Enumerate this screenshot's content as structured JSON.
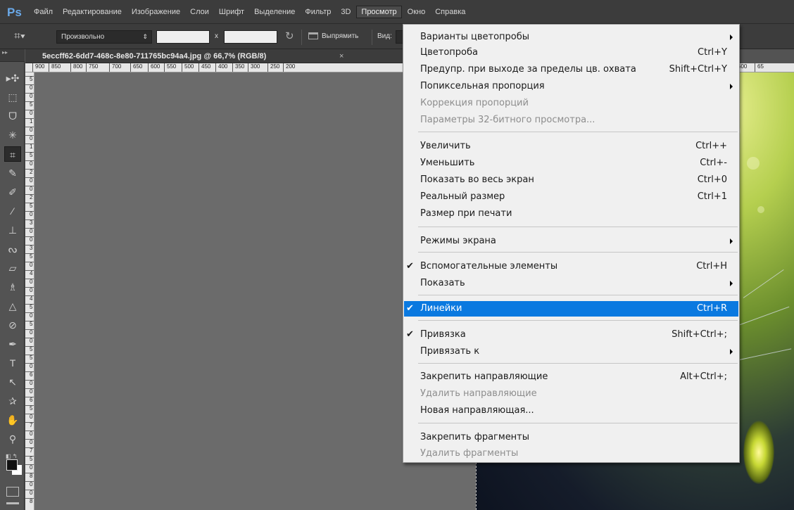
{
  "app": {
    "logo": "Ps"
  },
  "menubar": {
    "items": [
      "Файл",
      "Редактирование",
      "Изображение",
      "Слои",
      "Шрифт",
      "Выделение",
      "Фильтр",
      "3D",
      "Просмотр",
      "Окно",
      "Справка"
    ],
    "active": "Просмотр"
  },
  "options": {
    "preset": "Произвольно",
    "width_value": "",
    "x_label": "x",
    "height_value": "",
    "straighten_label": "Выпрямить",
    "view_label": "Вид:"
  },
  "document": {
    "title": "5eccff62-6dd7-468c-8e80-711765bc94a4.jpg @ 66,7% (RGB/8)",
    "close": "×"
  },
  "ruler_top": [
    "900",
    "850",
    "800",
    "750",
    "700",
    "650",
    "600",
    "550",
    "500",
    "450",
    "400",
    "350",
    "300",
    "250",
    "200",
    "350",
    "600",
    "65"
  ],
  "ruler_left": [
    "5",
    "0",
    "0",
    "5",
    "0",
    "1",
    "0",
    "0",
    "1",
    "5",
    "0",
    "2",
    "0",
    "0",
    "2",
    "5",
    "0",
    "3",
    "0",
    "0",
    "3",
    "5",
    "0",
    "4",
    "0",
    "0",
    "4",
    "5",
    "0",
    "5",
    "0",
    "0",
    "5",
    "5",
    "0",
    "6",
    "0",
    "0",
    "6",
    "5",
    "0",
    "7",
    "0",
    "0",
    "7",
    "5",
    "0",
    "8",
    "0",
    "0",
    "8"
  ],
  "view_menu": {
    "items": [
      {
        "label": "Варианты цветопробы",
        "shortcut": "",
        "submenu": true
      },
      {
        "label": "Цветопроба",
        "shortcut": "Ctrl+Y"
      },
      {
        "label": "Предупр. при выходе за пределы цв. охвата",
        "shortcut": "Shift+Ctrl+Y"
      },
      {
        "label": "Попиксельная пропорция",
        "shortcut": "",
        "submenu": true
      },
      {
        "label": "Коррекция пропорций",
        "shortcut": "",
        "disabled": true
      },
      {
        "label": "Параметры 32-битного просмотра...",
        "shortcut": "",
        "disabled": true
      },
      {
        "label": "Увеличить",
        "shortcut": "Ctrl++"
      },
      {
        "label": "Уменьшить",
        "shortcut": "Ctrl+-"
      },
      {
        "label": "Показать во весь экран",
        "shortcut": "Ctrl+0"
      },
      {
        "label": "Реальный размер",
        "shortcut": "Ctrl+1"
      },
      {
        "label": "Размер при печати",
        "shortcut": ""
      },
      {
        "label": "Режимы экрана",
        "shortcut": "",
        "submenu": true
      },
      {
        "label": "Вспомогательные элементы",
        "shortcut": "Ctrl+H",
        "checked": true
      },
      {
        "label": "Показать",
        "shortcut": "",
        "submenu": true
      },
      {
        "label": "Линейки",
        "shortcut": "Ctrl+R",
        "checked": true,
        "highlighted": true
      },
      {
        "label": "Привязка",
        "shortcut": "Shift+Ctrl+;",
        "checked": true
      },
      {
        "label": "Привязать к",
        "shortcut": "",
        "submenu": true
      },
      {
        "label": "Закрепить направляющие",
        "shortcut": "Alt+Ctrl+;"
      },
      {
        "label": "Удалить направляющие",
        "shortcut": "",
        "disabled": true
      },
      {
        "label": "Новая направляющая...",
        "shortcut": ""
      },
      {
        "label": "Закрепить фрагменты",
        "shortcut": ""
      },
      {
        "label": "Удалить фрагменты",
        "shortcut": "",
        "disabled": true
      }
    ],
    "checkmark": "✔"
  },
  "colors": {
    "highlight": "#0a79e0",
    "menu_bg": "#f0f0f0",
    "chrome": "#3c3c3c",
    "canvas": "#6b6b6b"
  }
}
